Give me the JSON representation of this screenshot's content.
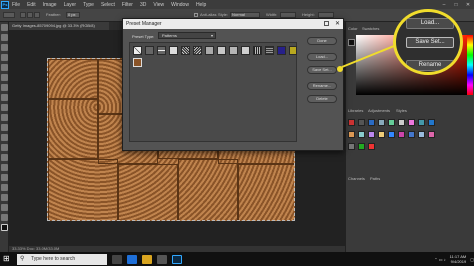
{
  "menubar": {
    "logo": "Ps",
    "items": [
      "File",
      "Edit",
      "Image",
      "Layer",
      "Type",
      "Select",
      "Filter",
      "3D",
      "View",
      "Window",
      "Help"
    ]
  },
  "options": {
    "feather": "Feather:",
    "feather_value": "0 px",
    "antialias": "Anti-alias",
    "style": "Style:",
    "style_value": "Normal",
    "width": "Width:",
    "height": "Height:",
    "mask": "Select and Mask..."
  },
  "document": {
    "tab": "Getty Images-85709094.jpg @ 33.3% (RGB/8)",
    "status": "33.33%   Doc: 33.0M/33.0M"
  },
  "panels": {
    "color_tab": "Color",
    "swatches_tab": "Swatches",
    "libraries_tab": "Libraries",
    "adjustments_tab": "Adjustments",
    "styles_tab": "Styles",
    "channels_tab": "Channels",
    "paths_tab": "Paths"
  },
  "dialog": {
    "title": "Preset Manager",
    "preset_type_label": "Preset Type:",
    "preset_type_value": "Patterns",
    "buttons": {
      "done": "Done",
      "load": "Load...",
      "save_set": "Save Set...",
      "rename": "Rename...",
      "delete": "Delete"
    }
  },
  "callout": {
    "load": "Load...",
    "save_set": "Save Set...",
    "rename": "Rename"
  },
  "taskbar": {
    "search_placeholder": "Type here to search",
    "time": "11:17 AM",
    "date": "9/4/2019"
  },
  "colors": {
    "accent_yellow": "#f0dc2c",
    "ps_blue": "#31a8ff"
  }
}
